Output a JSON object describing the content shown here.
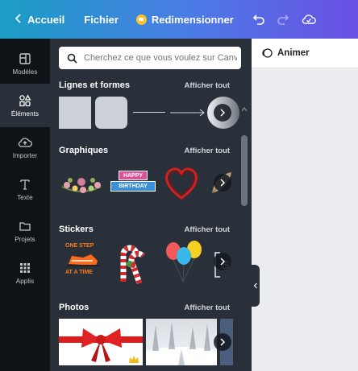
{
  "topbar": {
    "home_label": "Accueil",
    "file_label": "Fichier",
    "resize_label": "Redimensionner"
  },
  "rail": {
    "items": [
      {
        "label": "Modèles",
        "icon": "templates-icon"
      },
      {
        "label": "Éléments",
        "icon": "elements-icon",
        "active": true
      },
      {
        "label": "Importer",
        "icon": "upload-icon"
      },
      {
        "label": "Texte",
        "icon": "text-icon"
      },
      {
        "label": "Projets",
        "icon": "folder-icon"
      },
      {
        "label": "Applis",
        "icon": "apps-grid-icon"
      }
    ]
  },
  "search": {
    "placeholder": "Cherchez ce que vous voulez sur Canva"
  },
  "sections": [
    {
      "title": "Lignes et formes",
      "show_all": "Afficher tout"
    },
    {
      "title": "Graphiques",
      "show_all": "Afficher tout"
    },
    {
      "title": "Stickers",
      "show_all": "Afficher tout"
    },
    {
      "title": "Photos",
      "show_all": "Afficher tout"
    }
  ],
  "stickers": {
    "happy_birthday_line1": "HAPPY",
    "happy_birthday_line2": "BIRTHDAY",
    "one_step_line1": "ONE STEP",
    "one_step_line2": "AT A TIME"
  },
  "toolbar": {
    "animate_label": "Animer"
  },
  "colors": {
    "panel_bg": "#293039",
    "rail_bg": "#0e1318",
    "canvas_bg": "#ebecf0"
  }
}
